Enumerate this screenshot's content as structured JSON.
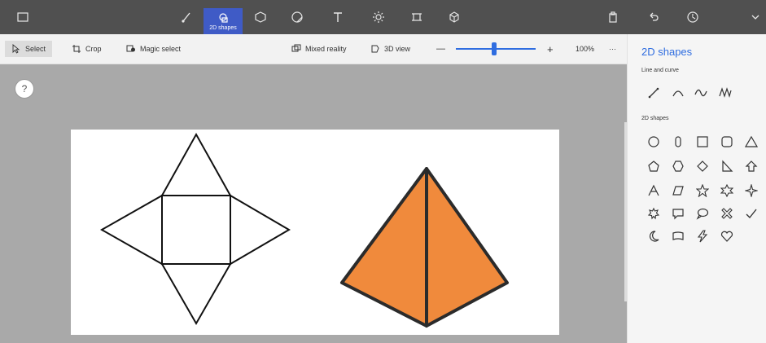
{
  "topbar": {
    "active_tool_label": "2D shapes",
    "icons": [
      "menu-icon",
      "brushes-icon",
      "2d-shapes-icon",
      "3d-shapes-icon",
      "stickers-icon",
      "text-icon",
      "effects-icon",
      "canvas-icon",
      "3d-library-icon",
      "paste-icon",
      "undo-icon",
      "history-icon",
      "chevron-down-icon"
    ]
  },
  "toolbar": {
    "select_label": "Select",
    "crop_label": "Crop",
    "magic_select_label": "Magic select",
    "mixed_reality_label": "Mixed reality",
    "view3d_label": "3D view",
    "zoom_minus": "—",
    "zoom_plus": "+",
    "zoom_value": "100%",
    "more": "···"
  },
  "canvas": {
    "help_label": "?",
    "pyramid_fill": "#f08a3c"
  },
  "panel": {
    "title": "2D shapes",
    "line_section": "Line and curve",
    "shape_section": "2D shapes"
  }
}
